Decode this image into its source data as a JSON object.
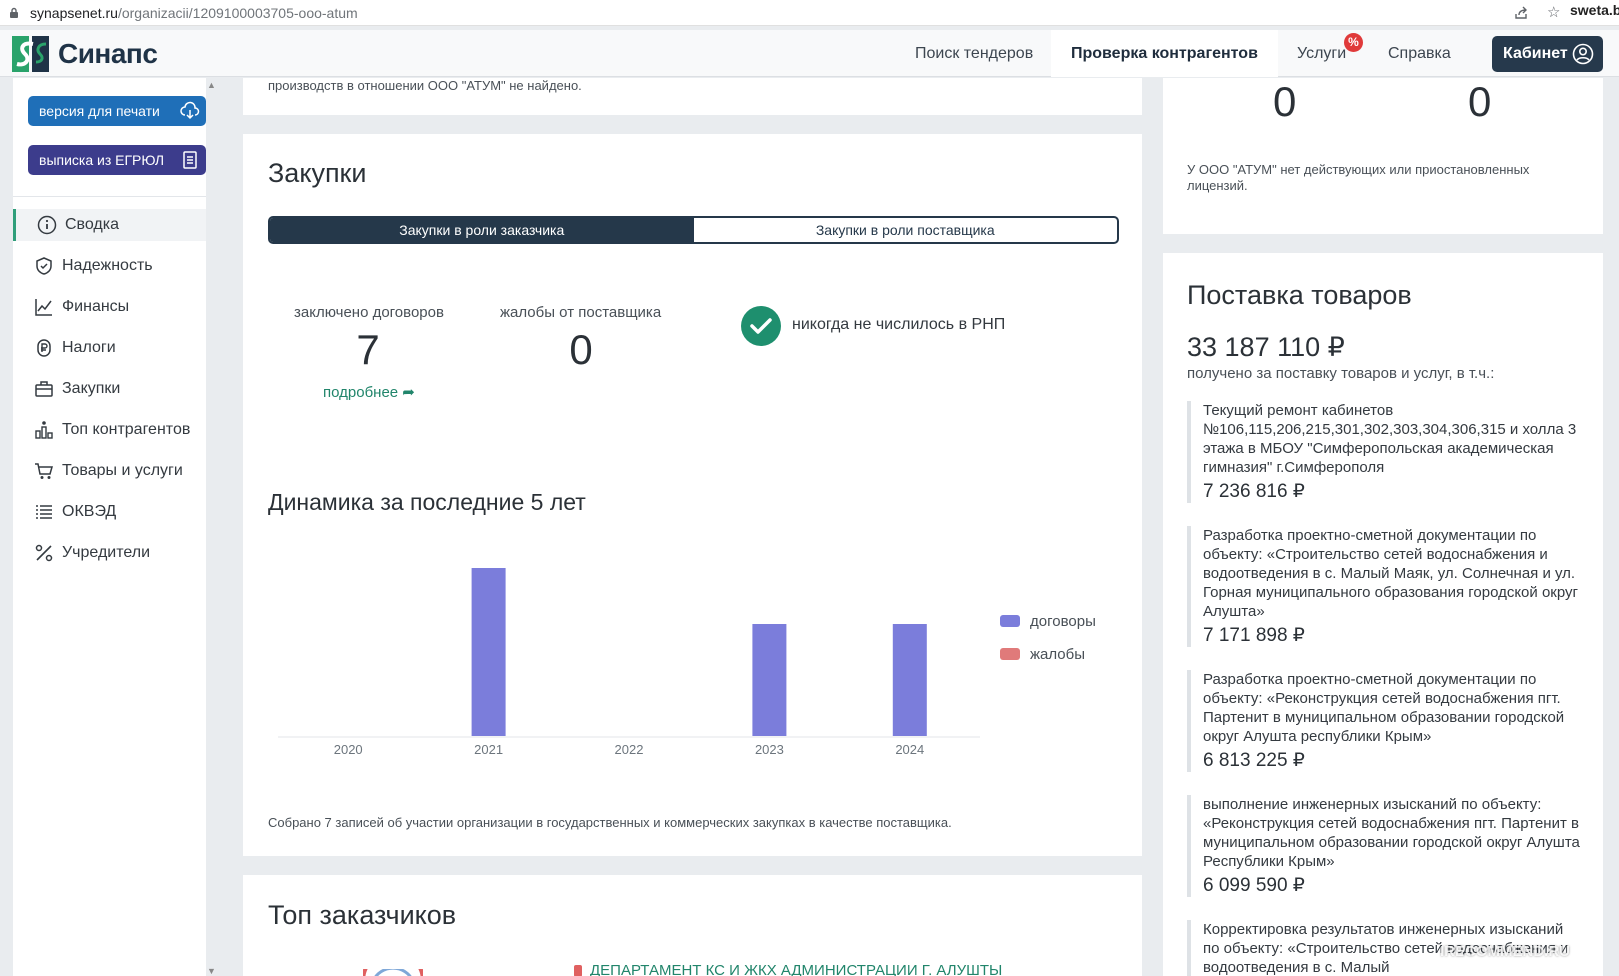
{
  "browser": {
    "url_domain": "synapsenet.ru",
    "url_path": "/organizacii/1209100003705-ooo-atum",
    "watermark": "sweta.bu"
  },
  "header": {
    "brand": "Синапс",
    "nav": [
      "Поиск тендеров",
      "Проверка контрагентов",
      "Услуги",
      "Справка"
    ],
    "badge": "%",
    "cabinet": "Кабинет"
  },
  "sidebar": {
    "print_button": "версия для печати",
    "egrul_button": "выписка из ЕГРЮЛ",
    "items": [
      {
        "label": "Сводка",
        "icon": "info-icon"
      },
      {
        "label": "Надежность",
        "icon": "shield-icon"
      },
      {
        "label": "Финансы",
        "icon": "chart-line-icon"
      },
      {
        "label": "Налоги",
        "icon": "tax-icon"
      },
      {
        "label": "Закупки",
        "icon": "briefcase-icon"
      },
      {
        "label": "Топ контрагентов",
        "icon": "ranking-icon"
      },
      {
        "label": "Товары и услуги",
        "icon": "cart-icon"
      },
      {
        "label": "ОКВЭД",
        "icon": "list-icon"
      },
      {
        "label": "Учредители",
        "icon": "percent-icon"
      }
    ]
  },
  "top_strip": {
    "text": "производств в отношении ООО \"АТУМ\" не найдено."
  },
  "purchases": {
    "title": "Закупки",
    "tabs": [
      "Закупки в роли заказчика",
      "Закупки в роли поставщика"
    ],
    "contracts_label": "заключено договоров",
    "contracts_value": "7",
    "complaints_label": "жалобы от поставщика",
    "complaints_value": "0",
    "more_link": "подробнее ➦",
    "rnp_text": "никогда не числилось в РНП",
    "dynamics_title": "Динамика за последние 5 лет",
    "footnote": "Собрано 7 записей об участии организации в государственных и коммерческих закупках в качестве поставщика."
  },
  "chart_data": {
    "type": "bar",
    "categories": [
      "2020",
      "2021",
      "2022",
      "2023",
      "2024"
    ],
    "series": [
      {
        "name": "договоры",
        "values": [
          0,
          3,
          0,
          2,
          2
        ],
        "color": "#7b7ddb"
      },
      {
        "name": "жалобы",
        "values": [
          0,
          0,
          0,
          0,
          0
        ],
        "color": "#e07a7a"
      }
    ],
    "ylim": [
      0,
      3
    ],
    "legend": "right"
  },
  "top_customers": {
    "title": "Топ заказчиков",
    "first_customer": "ДЕПАРТАМЕНТ КС И ЖКХ АДМИНИСТРАЦИИ Г. АЛУШТЫ"
  },
  "licenses": {
    "value_1": "0",
    "value_2": "0",
    "text": "У ООО \"АТУМ\" нет действующих или приостановленных лицензий."
  },
  "supply": {
    "title": "Поставка товаров",
    "total": "33 187 110 ₽",
    "subtitle": "получено за поставку товаров и услуг, в т.ч.:",
    "items": [
      {
        "desc": "Текущий ремонт кабинетов №106,115,206,215,301,302,303,304,306,315 и холла 3 этажа в МБОУ \"Симферопольская академическая гимназия\" г.Симферополя",
        "amount": "7 236 816 ₽"
      },
      {
        "desc": "Разработка проектно-сметной документации по объекту: «Строительство сетей водоснабжения и водоотведения в с. Малый Маяк, ул. Солнечная и ул. Горная муниципального образования городской округ Алушта»",
        "amount": "7 171 898 ₽"
      },
      {
        "desc": "Разработка проектно-сметной документации по объекту: «Реконструкция сетей водоснабжения пгт. Партенит в муниципальном образовании городской округ Алушта республики Крым»",
        "amount": "6 813 225 ₽"
      },
      {
        "desc": "выполнение инженерных изысканий по объекту: «Реконструкция сетей водоснабжения пгт. Партенит в муниципальном образовании городской округ Алушта Республики Крым»",
        "amount": "6 099 590 ₽"
      },
      {
        "desc": "Корректировка результатов инженерных изысканий по объекту: «Строительство сетей водоснабжения и водоотведения в с. Малый",
        "amount": ""
      }
    ]
  },
  "footer_watermark": "IRECOMMEND.RU"
}
